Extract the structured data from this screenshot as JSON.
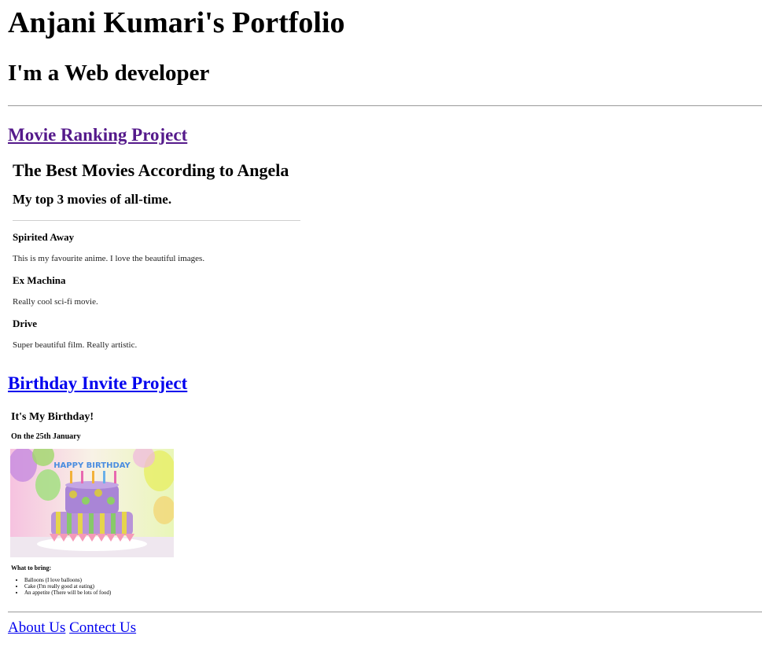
{
  "header": {
    "title": "Anjani Kumari's Portfolio",
    "subtitle": "I'm a Web developer"
  },
  "projects": [
    {
      "link": "Movie Ranking Project",
      "preview": {
        "title": "The Best Movies According to Angela",
        "subtitle": "My top 3 movies of all-time.",
        "movies": [
          {
            "name": "Spirited Away",
            "desc": "This is my favourite anime. I love the beautiful images."
          },
          {
            "name": "Ex Machina",
            "desc": "Really cool sci-fi movie."
          },
          {
            "name": "Drive",
            "desc": "Super beautiful film. Really artistic."
          }
        ]
      }
    },
    {
      "link": "Birthday Invite Project",
      "preview": {
        "title": "It's My Birthday!",
        "subtitle": "On the 25th January",
        "cake_text": "HAPPY BIRTHDAY",
        "bring_title": "What to bring:",
        "items": [
          "Balloons (I love balloons)",
          "Cake (I'm really good at eating)",
          "An appetite (There will be lots of food)"
        ]
      }
    }
  ],
  "footer": {
    "about": "About Us",
    "contact": "Contect Us"
  },
  "colors": {
    "link": "#0000ee",
    "visited_link": "#551a8b",
    "rule": "#9a9a9a"
  }
}
